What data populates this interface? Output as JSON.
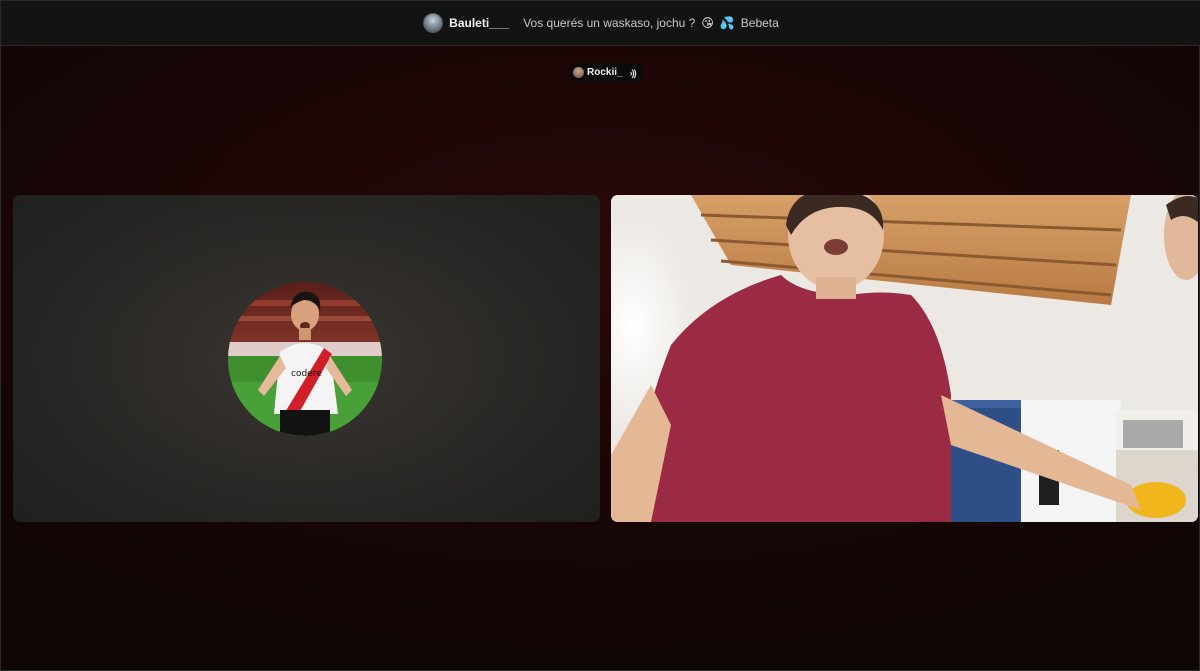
{
  "header": {
    "username": "Bauleti___",
    "status_text": "Vos querés un waskaso, jochu ?",
    "emoji_1": "😘",
    "emoji_2": "💦",
    "status_name": "Bebeta"
  },
  "speaker": {
    "name": "Rockii_",
    "speaking_indicator": "›))"
  },
  "tiles": [
    {
      "kind": "avatar",
      "avatar_desc": "football-player-avatar"
    },
    {
      "kind": "camera-video"
    }
  ],
  "colors": {
    "background": "#1c0606",
    "header": "#131313",
    "shirt": "#9b2a44"
  }
}
